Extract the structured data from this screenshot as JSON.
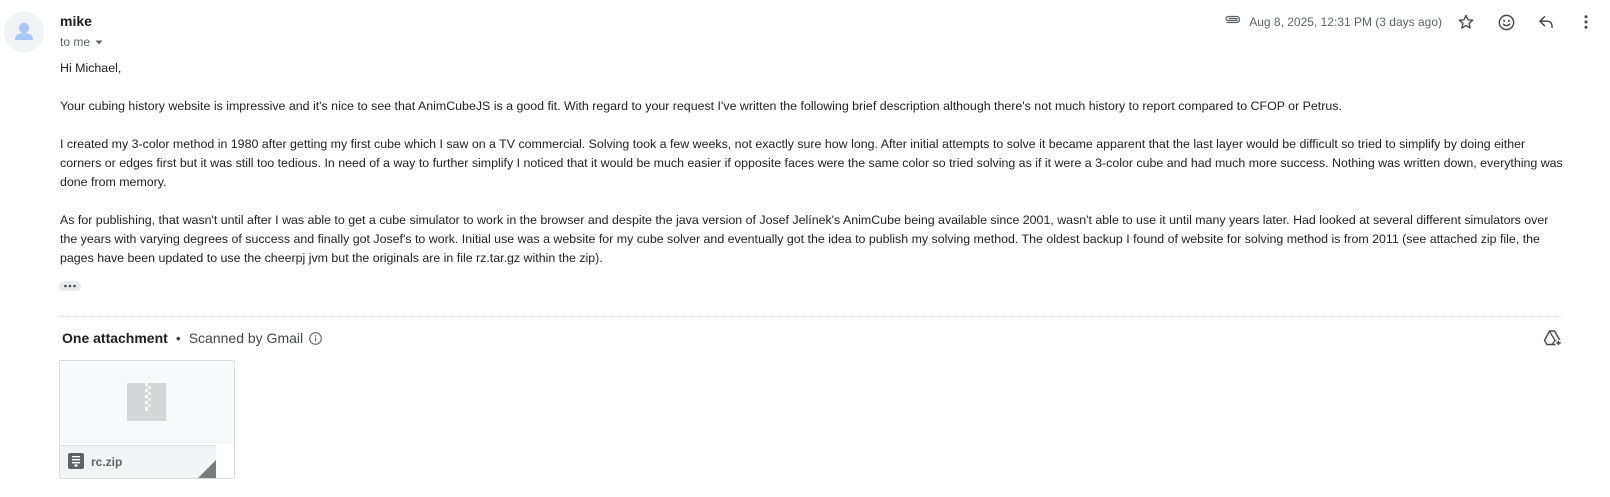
{
  "sender": {
    "name": "mike",
    "recipient_label": "to me"
  },
  "header": {
    "timestamp": "Aug 8, 2025, 12:31 PM (3 days ago)",
    "icons": [
      "attachment-clip-icon",
      "star-icon",
      "emoji-icon",
      "reply-icon",
      "more-vert-icon"
    ]
  },
  "body": {
    "greeting": "Hi Michael,",
    "paragraphs": [
      "Your cubing history website is impressive and it's nice to see that AnimCubeJS is a good fit.  With regard to your request I've written the following brief description although there's not much history to report compared to CFOP or Petrus.",
      "I created my 3-color method in 1980 after getting my first cube which I saw on a TV commercial.  Solving took a few weeks, not exactly sure how long.  After initial attempts to solve it became apparent that the last layer would be difficult so tried to simplify by doing either corners or edges first but it was still too tedious.  In need of a way to further simplify I noticed that it would be much easier if opposite faces were the same color so tried solving as if it were a 3-color cube and had much more success.  Nothing was written down, everything was done from memory.",
      "As for publishing, that wasn't until after I was able to get a cube simulator to work in the browser and despite the java version of Josef Jelínek's AnimCube being available since 2001, wasn't able to use it until many years later.  Had looked at several different simulators over the years with varying degrees of success and finally got Josef's to work. Initial use was a website for my cube solver and eventually got the idea to publish my solving method.  The oldest backup I found of website for solving method is from 2011 (see attached zip file, the pages have been updated to use the cheerpj jvm but the originals are in file rz.tar.gz within the zip)."
    ]
  },
  "attachments": {
    "title": "One attachment",
    "scanned_label": "Scanned by Gmail",
    "separator": "•",
    "files": [
      {
        "name": "rc.zip"
      }
    ]
  }
}
